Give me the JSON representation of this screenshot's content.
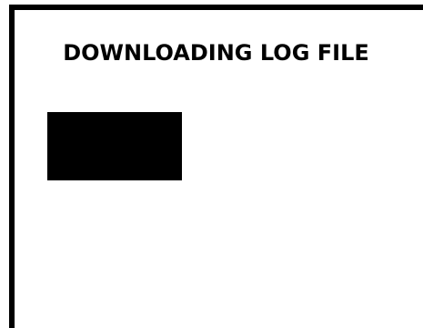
{
  "dialog": {
    "title": "DOWNLOADING LOG FILE"
  },
  "colors": {
    "background": "#ffffff",
    "border": "#000000",
    "progress_fill": "#000000",
    "text": "#000000"
  }
}
